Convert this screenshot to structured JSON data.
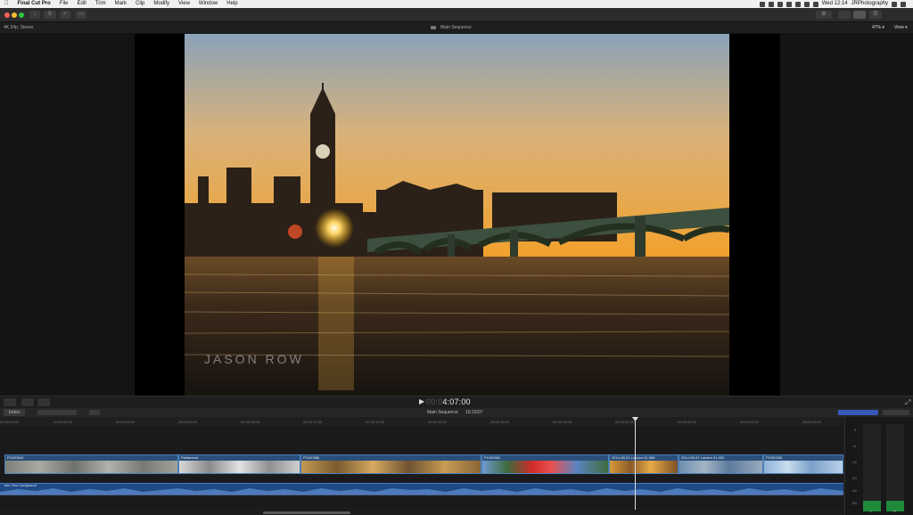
{
  "menubar": {
    "apple": "",
    "app_name": "Final Cut Pro",
    "menus": [
      "File",
      "Edit",
      "Trim",
      "Mark",
      "Clip",
      "Modify",
      "View",
      "Window",
      "Help"
    ],
    "clock": "Wed 12:14",
    "user": "JRPhotography"
  },
  "viewer": {
    "format_label": "4K 24p, Stereo",
    "title": "Main Sequence",
    "zoom": "47%",
    "view_label": "View",
    "watermark": "JASON ROW",
    "timecode": "4:07:00"
  },
  "timeline": {
    "index_label": "Index",
    "sequence_name": "Main Sequence",
    "sequence_time": "10:15/07",
    "ruler_ticks": [
      "00:00:00:00",
      "00:00:02:00",
      "00:00:04:00",
      "00:00:06:00",
      "00:00:08:00",
      "00:00:10:00",
      "00:00:12:00",
      "00:00:14:00",
      "00:00:16:00",
      "00:00:18:00",
      "00:00:20:00",
      "00:00:22:00",
      "00:00:24:00",
      "00:00:26:00"
    ],
    "clips": [
      {
        "name": "P1000044"
      },
      {
        "name": "Parliament"
      },
      {
        "name": "P1000386"
      },
      {
        "name": "P1000081"
      },
      {
        "name": "2014-08-31 London 01-086"
      },
      {
        "name": "2014-08-31 London 01-052"
      },
      {
        "name": "P1000328"
      }
    ],
    "audio_label": "Into Two Compound"
  },
  "meters": {
    "scale": [
      "0",
      "-6",
      "-12",
      "-20",
      "-30",
      "-50"
    ],
    "channels": [
      "L",
      "R"
    ]
  },
  "colors": {
    "clip_blue": "#2a4f7a",
    "audio_blue": "#1f4a86",
    "sky_top": "#8aa2b8",
    "sky_bottom": "#f2a12c"
  }
}
